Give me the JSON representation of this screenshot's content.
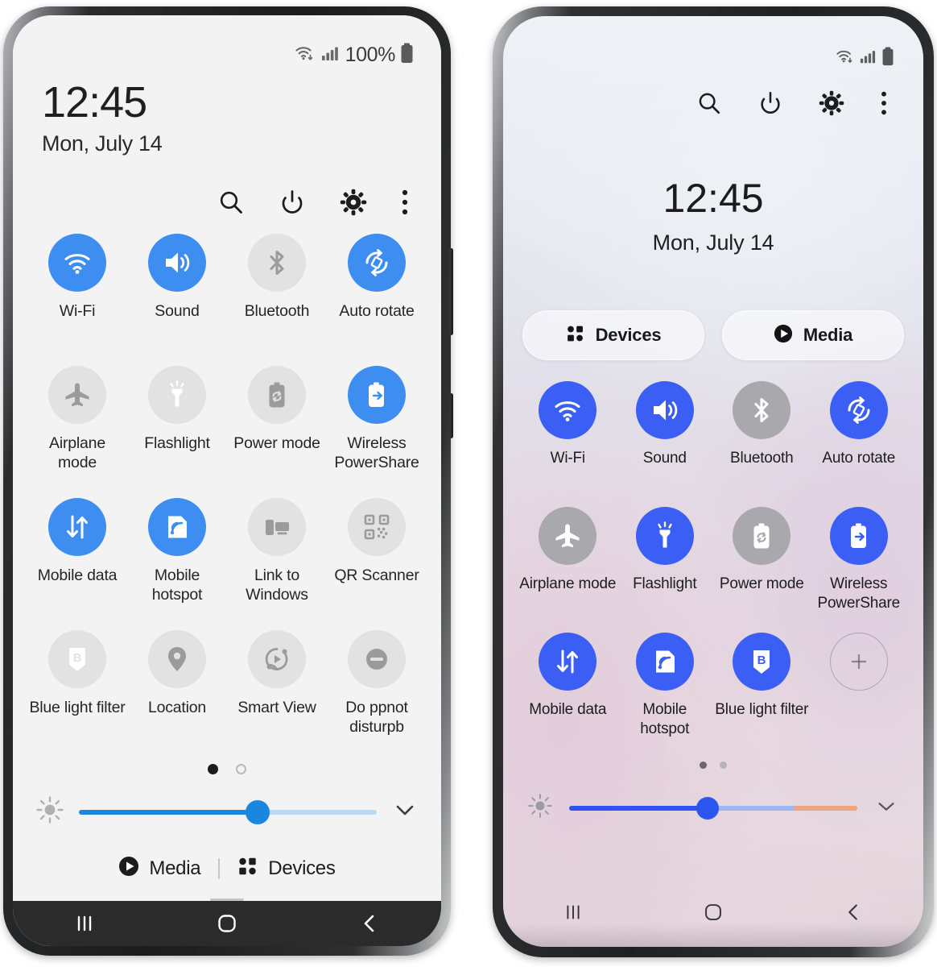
{
  "accent": {
    "left_tile_on": "#3d8ef0",
    "left_tile_off": "#e2e2e2",
    "right_tile_on": "#3b5ef5",
    "right_tile_off": "#a9a8ad",
    "left_slider": "#1a86e0",
    "right_slider": "#2a55ef",
    "right_slider_tail": "#f0a57e"
  },
  "left_phone": {
    "status_bar": {
      "wifi_icon": "wifi-icon",
      "signal_icon": "cellular-signal-icon",
      "battery_percent": "100%",
      "battery_icon": "battery-full-icon"
    },
    "clock": {
      "time": "12:45",
      "date": "Mon, July 14"
    },
    "header_actions": [
      {
        "name": "search-icon",
        "label": "Search"
      },
      {
        "name": "power-icon",
        "label": "Power"
      },
      {
        "name": "settings-gear-icon",
        "label": "Settings"
      },
      {
        "name": "more-options-icon",
        "label": "More options"
      }
    ],
    "tiles": [
      {
        "label": "Wi-Fi",
        "icon": "wifi-icon",
        "state": "on"
      },
      {
        "label": "Sound",
        "icon": "sound-icon",
        "state": "on"
      },
      {
        "label": "Bluetooth",
        "icon": "bluetooth-icon",
        "state": "off"
      },
      {
        "label": "Auto rotate",
        "icon": "auto-rotate-icon",
        "state": "on"
      },
      {
        "label": "Airplane mode",
        "icon": "airplane-icon",
        "state": "off"
      },
      {
        "label": "Flashlight",
        "icon": "flashlight-icon",
        "state": "off"
      },
      {
        "label": "Power mode",
        "icon": "power-mode-icon",
        "state": "off"
      },
      {
        "label": "Wireless PowerShare",
        "icon": "wireless-powershare-icon",
        "state": "on"
      },
      {
        "label": "Mobile data",
        "icon": "mobile-data-icon",
        "state": "on"
      },
      {
        "label": "Mobile hotspot",
        "icon": "mobile-hotspot-icon",
        "state": "on"
      },
      {
        "label": "Link to Windows",
        "icon": "link-to-windows-icon",
        "state": "off"
      },
      {
        "label": "QR Scanner",
        "icon": "qr-scanner-icon",
        "state": "off"
      },
      {
        "label": "Blue light filter",
        "icon": "blue-light-filter-icon",
        "state": "off"
      },
      {
        "label": "Location",
        "icon": "location-pin-icon",
        "state": "off"
      },
      {
        "label": "Smart View",
        "icon": "smart-view-icon",
        "state": "off"
      },
      {
        "label": "Do ppnot disturpb",
        "icon": "do-not-disturb-icon",
        "state": "off"
      }
    ],
    "page_indicator": {
      "pages": 2,
      "active": 1
    },
    "brightness": {
      "icon": "brightness-icon",
      "value": 60,
      "expand_icon": "chevron-down-icon"
    },
    "footer": {
      "media_label": "Media",
      "media_icon": "play-circle-icon",
      "devices_label": "Devices",
      "devices_icon": "devices-grid-icon"
    },
    "nav_bar": {
      "recents_icon": "recents-icon",
      "home_icon": "home-icon",
      "back_icon": "back-icon"
    }
  },
  "right_phone": {
    "status_bar": {
      "wifi_icon": "wifi-icon",
      "signal_icon": "cellular-signal-icon",
      "battery_icon": "battery-full-icon"
    },
    "header_actions": [
      {
        "name": "search-icon",
        "label": "Search"
      },
      {
        "name": "power-icon",
        "label": "Power"
      },
      {
        "name": "settings-gear-icon",
        "label": "Settings"
      },
      {
        "name": "more-options-icon",
        "label": "More options"
      }
    ],
    "clock": {
      "time": "12:45",
      "date": "Mon, July 14"
    },
    "pills": [
      {
        "label": "Devices",
        "icon": "devices-grid-icon"
      },
      {
        "label": "Media",
        "icon": "play-circle-icon"
      }
    ],
    "tiles": [
      {
        "label": "Wi-Fi",
        "icon": "wifi-icon",
        "state": "on"
      },
      {
        "label": "Sound",
        "icon": "sound-icon",
        "state": "on"
      },
      {
        "label": "Bluetooth",
        "icon": "bluetooth-icon",
        "state": "off"
      },
      {
        "label": "Auto rotate",
        "icon": "auto-rotate-icon",
        "state": "on"
      },
      {
        "label": "Airplane mode",
        "icon": "airplane-icon",
        "state": "off"
      },
      {
        "label": "Flashlight",
        "icon": "flashlight-icon",
        "state": "on"
      },
      {
        "label": "Power mode",
        "icon": "power-mode-icon",
        "state": "off"
      },
      {
        "label": "Wireless PowerShare",
        "icon": "wireless-powershare-icon",
        "state": "on"
      },
      {
        "label": "Mobile data",
        "icon": "mobile-data-icon",
        "state": "on"
      },
      {
        "label": "Mobile hotspot",
        "icon": "mobile-hotspot-icon",
        "state": "on"
      },
      {
        "label": "Blue light filter",
        "icon": "blue-light-filter-icon",
        "state": "on"
      },
      {
        "label": "",
        "icon": "add-tile-icon",
        "state": "add"
      }
    ],
    "page_indicator": {
      "pages": 2,
      "active": 1
    },
    "brightness": {
      "icon": "brightness-icon",
      "value": 48,
      "tail": 22,
      "expand_icon": "chevron-down-icon"
    },
    "nav_bar": {
      "recents_icon": "recents-icon",
      "home_icon": "home-icon",
      "back_icon": "back-icon"
    }
  }
}
